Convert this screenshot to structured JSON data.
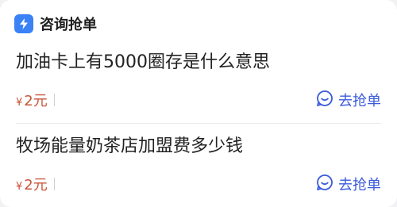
{
  "header": {
    "title": "咨询抢单",
    "logo_icon": "app-bolt-icon"
  },
  "items": [
    {
      "title": "加油卡上有5000圈存是什么意思",
      "currency": "¥",
      "price": "2元",
      "action_label": "去抢单",
      "action_icon": "smile-chat-icon"
    },
    {
      "title": "牧场能量奶茶店加盟费多少钱",
      "currency": "¥",
      "price": "2元",
      "action_label": "去抢单",
      "action_icon": "smile-chat-icon"
    }
  ],
  "colors": {
    "accent": "#3b5bdb",
    "price": "#c8553a",
    "logo": "#3b82f6"
  }
}
